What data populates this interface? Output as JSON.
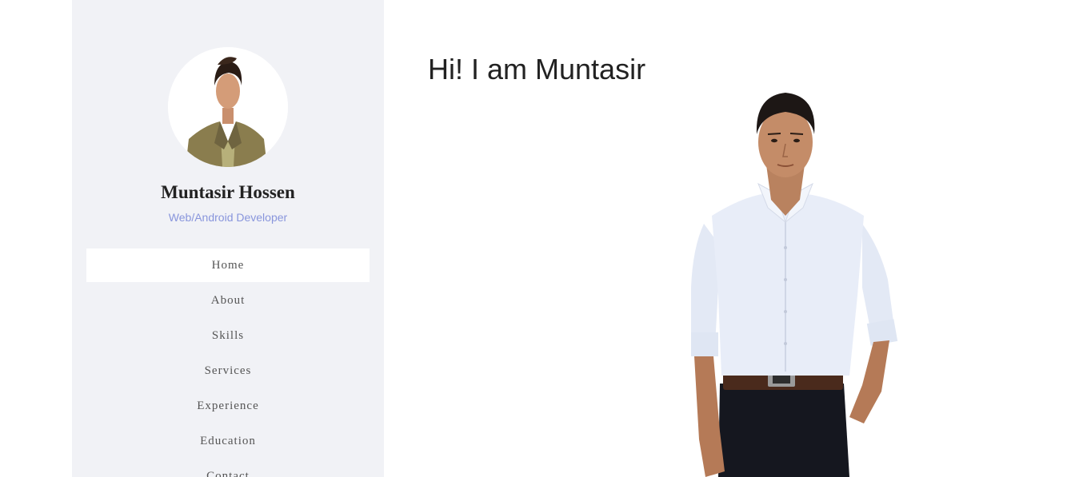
{
  "sidebar": {
    "name": "Muntasir Hossen",
    "role": "Web/Android Developer",
    "nav": [
      {
        "label": "Home",
        "active": true
      },
      {
        "label": "About",
        "active": false
      },
      {
        "label": "Skills",
        "active": false
      },
      {
        "label": "Services",
        "active": false
      },
      {
        "label": "Experience",
        "active": false
      },
      {
        "label": "Education",
        "active": false
      },
      {
        "label": "Contact",
        "active": false
      }
    ]
  },
  "main": {
    "greeting": "Hi! I am Muntasir"
  },
  "colors": {
    "sidebar_bg": "#f1f2f6",
    "role_text": "#8895dc",
    "heading_text": "#222222",
    "nav_text": "#555555"
  }
}
